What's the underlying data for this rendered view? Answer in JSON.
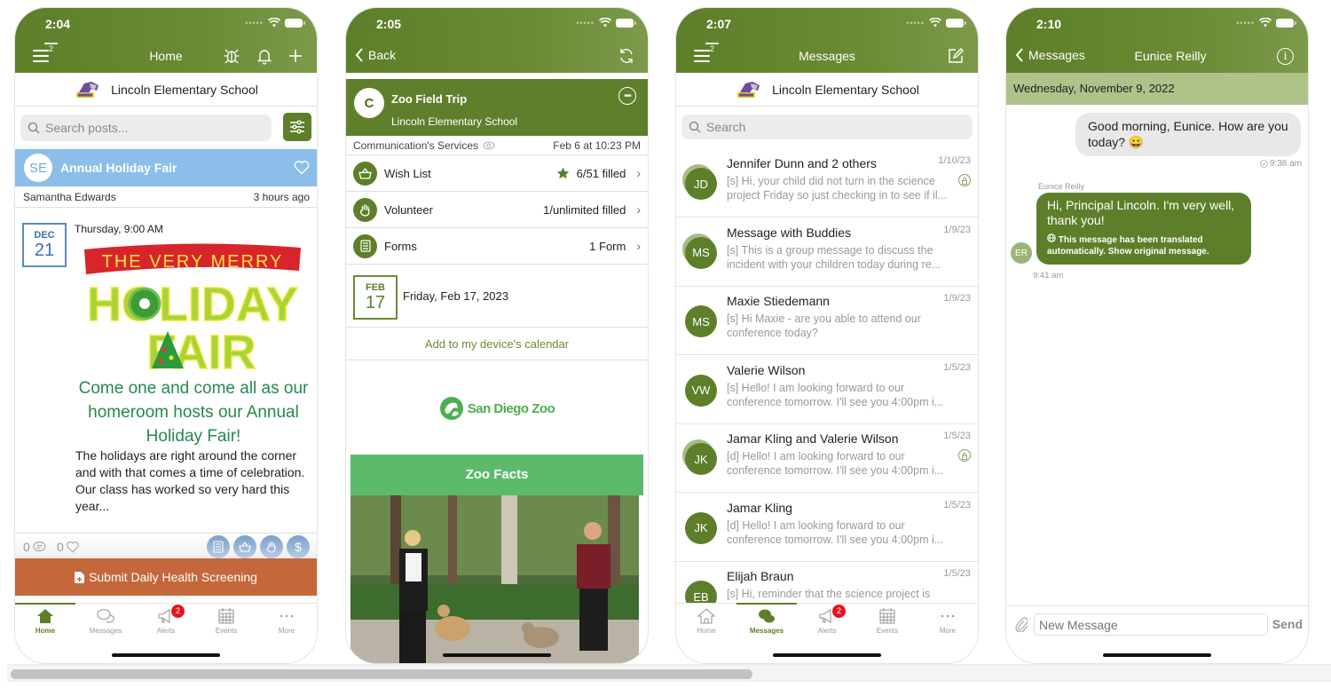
{
  "status_icons": [
    "signal-dots-icon",
    "wifi-icon",
    "battery-icon"
  ],
  "colors": {
    "brand_green": "#5e7f2a",
    "post_header_blue": "#8bbfea",
    "health_orange": "#c4673a",
    "zoo_green": "#5cba6c",
    "badge_red": "#e8141c",
    "day_bar": "#aec28a"
  },
  "school_name": "Lincoln Elementary School",
  "tabbar": {
    "tabs": [
      {
        "label": "Home",
        "icon": "home-icon"
      },
      {
        "label": "Messages",
        "icon": "chat-bubbles-icon"
      },
      {
        "label": "Alerts",
        "icon": "megaphone-icon",
        "badge": "2"
      },
      {
        "label": "Events",
        "icon": "calendar-icon"
      },
      {
        "label": "More",
        "icon": "ellipsis-icon"
      }
    ]
  },
  "screen1": {
    "time": "2:04",
    "title": "Home",
    "menu_badge": "2",
    "nav_icons": [
      "bug-icon",
      "bell-icon",
      "plus-icon"
    ],
    "search_placeholder": "Search posts...",
    "post": {
      "avatar_initials": "SE",
      "title": "Annual Holiday Fair",
      "author": "Samantha Edwards",
      "posted": "3 hours ago",
      "date_month": "DEC",
      "date_day": "21",
      "event_time": "Thursday, 9:00 AM",
      "art": {
        "banner": "THE VERY MERRY",
        "line1": "HOLIDAY",
        "line2": "FAIR"
      },
      "headline": "Come one and come all as our homeroom hosts our Annual Holiday Fair!",
      "body": "The holidays are right around the corner and with that comes a time of celebration. Our class has worked so very hard this year...",
      "comments": "0",
      "likes": "0",
      "service_icons": [
        "forms-icon",
        "wish-list-basket-icon",
        "volunteer-hand-icon",
        "payment-dollar-icon"
      ]
    },
    "health_button": "Submit Daily Health Screening",
    "active_tab": 0
  },
  "screen2": {
    "time": "2:05",
    "back_label": "Back",
    "avatar_initial": "C",
    "title": "Zoo Field Trip",
    "subtitle": "Lincoln Elementary School",
    "services_label": "Communication's Services",
    "posted": "Feb 6 at 10:23 PM",
    "rows": [
      {
        "label": "Wish List",
        "value": "6/51 filled",
        "icon": "basket-icon",
        "star": true
      },
      {
        "label": "Volunteer",
        "value": "1/unlimited filled",
        "icon": "hand-icon"
      },
      {
        "label": "Forms",
        "value": "1 Form",
        "icon": "form-icon"
      }
    ],
    "date_month": "FEB",
    "date_day": "17",
    "date_text": "Friday, Feb 17, 2023",
    "calendar_link": "Add to my device's calendar",
    "zoo_logo": "San Diego Zoo",
    "zoo_facts": "Zoo Facts"
  },
  "screen3": {
    "time": "2:07",
    "title": "Messages",
    "menu_badge": "2",
    "search_placeholder": "Search",
    "messages": [
      {
        "initials": "JD",
        "name": "Jennifer Dunn and 2 others",
        "date": "1/10/23",
        "preview": "[s] Hi, your child did not turn in the science project Friday so just checking in to see if il...",
        "group": true,
        "locked": true
      },
      {
        "initials": "MS",
        "name": "Message with Buddies",
        "date": "1/9/23",
        "preview": "[s] This is a group message to discuss the incident with your children today during re...",
        "group": true,
        "locked": false
      },
      {
        "initials": "MS",
        "name": "Maxie Stiedemann",
        "date": "1/9/23",
        "preview": "[s] Hi Maxie - are you able to attend our conference today?",
        "group": false,
        "locked": false
      },
      {
        "initials": "VW",
        "name": "Valerie Wilson",
        "date": "1/5/23",
        "preview": "[s] Hello! I am looking forward to our conference tomorrow. I'll see you 4:00pm i...",
        "group": false,
        "locked": false
      },
      {
        "initials": "JK",
        "name": "Jamar Kling and Valerie Wilson",
        "date": "1/5/23",
        "preview": "[d] Hello! I am looking forward to our conference tomorrow. I'll see you 4:00pm i...",
        "group": true,
        "locked": true
      },
      {
        "initials": "JK",
        "name": "Jamar Kling",
        "date": "1/5/23",
        "preview": "[d] Hello! I am looking forward to our conference tomorrow. I'll see you 4:00pm i...",
        "group": false,
        "locked": false
      },
      {
        "initials": "EB",
        "name": "Elijah Braun",
        "date": "1/5/23",
        "preview": "[s] Hi, reminder that the science project is",
        "group": false,
        "locked": false
      }
    ],
    "active_tab": 1
  },
  "screen4": {
    "time": "2:10",
    "back_label": "Messages",
    "title": "Eunice Reilly",
    "day": "Wednesday, November 9, 2022",
    "outgoing": {
      "text": "Good morning, Eunice. How are you today? 😀",
      "time": "9:38 am"
    },
    "incoming": {
      "sender": "Eunice Reilly",
      "initials": "ER",
      "text": "Hi, Principal Lincoln. I'm very well, thank you!",
      "translation_note": "This message has been translated automatically. Show original message.",
      "time": "9:41 am"
    },
    "input_placeholder": "New Message",
    "send_label": "Send"
  },
  "page_scrollbar": {
    "visible_fraction": 0.56
  }
}
